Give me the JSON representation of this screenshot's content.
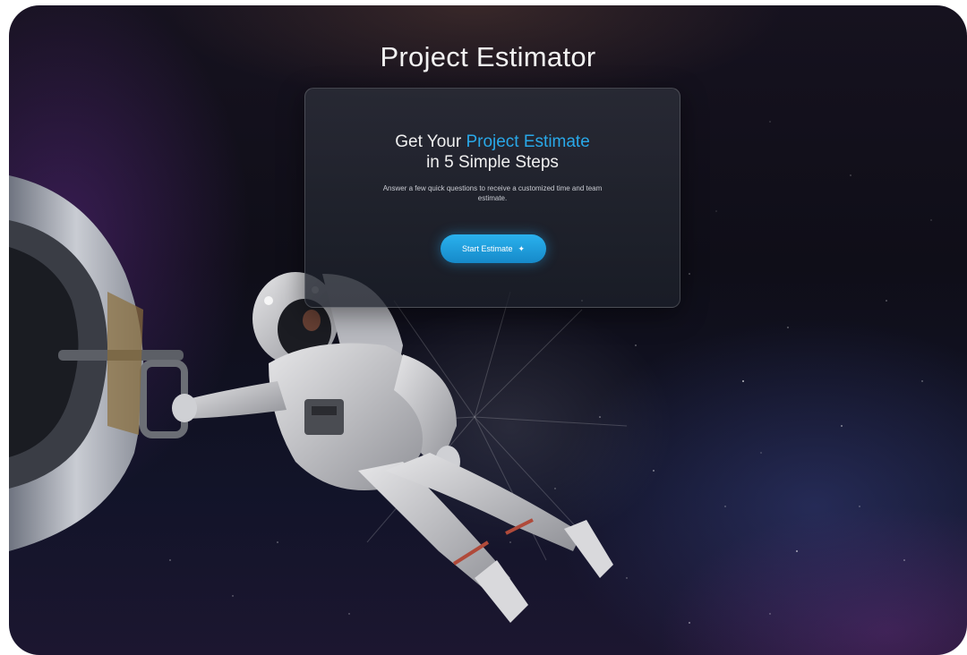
{
  "page": {
    "title": "Project Estimator"
  },
  "card": {
    "heading_prefix": "Get Your ",
    "heading_accent": "Project Estimate",
    "heading_line2": "in 5 Simple Steps",
    "subtitle": "Answer a few quick questions to receive a customized time and team estimate.",
    "button_label": "Start Estimate",
    "button_icon": "sparkle-icon"
  },
  "colors": {
    "accent": "#29a8e8",
    "button": "#1e9ddc",
    "background": "#121220"
  }
}
